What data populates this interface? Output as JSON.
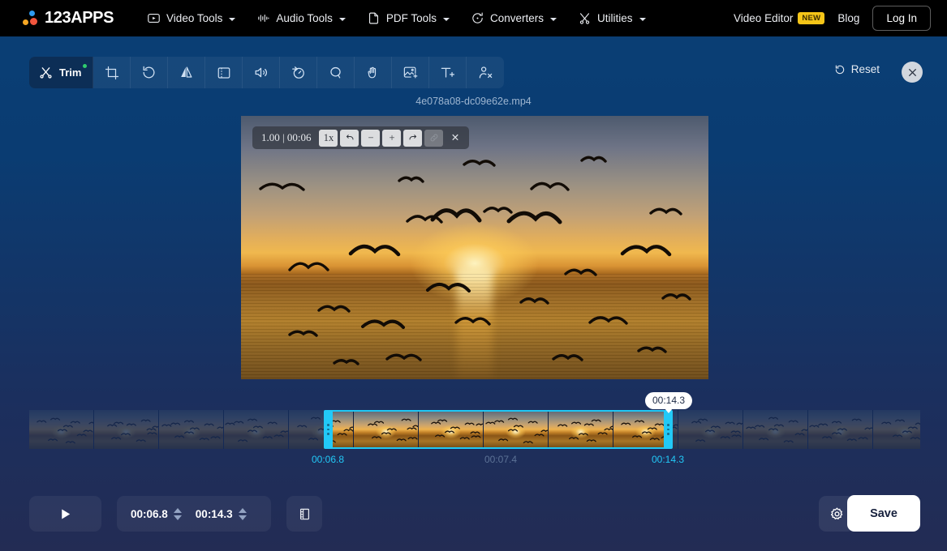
{
  "topnav": {
    "brand": "123APPS",
    "menus": [
      {
        "label": "Video Tools",
        "icon": "video-play-icon"
      },
      {
        "label": "Audio Tools",
        "icon": "audio-wave-icon"
      },
      {
        "label": "PDF Tools",
        "icon": "document-icon"
      },
      {
        "label": "Converters",
        "icon": "convert-refresh-icon"
      },
      {
        "label": "Utilities",
        "icon": "scissors-tools-icon"
      }
    ],
    "video_editor": "Video Editor",
    "new_badge": "NEW",
    "blog": "Blog",
    "login": "Log In"
  },
  "toolbar": {
    "active_tool": "Trim",
    "tools": [
      {
        "name": "trim",
        "icon": "scissors-icon",
        "label": "Trim",
        "active": true
      },
      {
        "name": "crop",
        "icon": "crop-icon"
      },
      {
        "name": "rotate",
        "icon": "rotate-left-icon"
      },
      {
        "name": "flip",
        "icon": "flip-horizontal-icon"
      },
      {
        "name": "resize",
        "icon": "resize-frame-icon"
      },
      {
        "name": "volume",
        "icon": "speaker-icon"
      },
      {
        "name": "speed",
        "icon": "speed-gauge-icon"
      },
      {
        "name": "loop",
        "icon": "loop-icon"
      },
      {
        "name": "stabilize",
        "icon": "wave-hand-icon"
      },
      {
        "name": "image-overlay",
        "icon": "add-image-icon"
      },
      {
        "name": "add-text",
        "icon": "add-text-icon"
      },
      {
        "name": "remove-person",
        "icon": "remove-person-icon"
      }
    ],
    "reset": "Reset",
    "close": "close-icon"
  },
  "filename": "4e078a08-dc09e62e.mp4",
  "overlay": {
    "readout": "1.00 | 00:06",
    "speed": "1x",
    "undo": "↶",
    "zoom_out": "−",
    "zoom_in": "+",
    "redo": "↷",
    "link": "link-icon",
    "close": "✕"
  },
  "timeline": {
    "start_label": "00:06.8",
    "mid_label": "00:07.4",
    "end_label": "00:14.3",
    "tooltip": "00:14.3",
    "handle_color": "#22c9f7",
    "frame_count": 14
  },
  "bottombar": {
    "play": "play-icon",
    "start_time": "00:06.8",
    "end_time": "00:14.3",
    "filmstrip": "filmstrip-icon",
    "settings": "gear-icon",
    "save": "Save"
  },
  "colors": {
    "accent": "#22c9f7",
    "badge": "#f5c518",
    "bg_top": "#0a3f75",
    "bg_bottom": "#232c54"
  }
}
